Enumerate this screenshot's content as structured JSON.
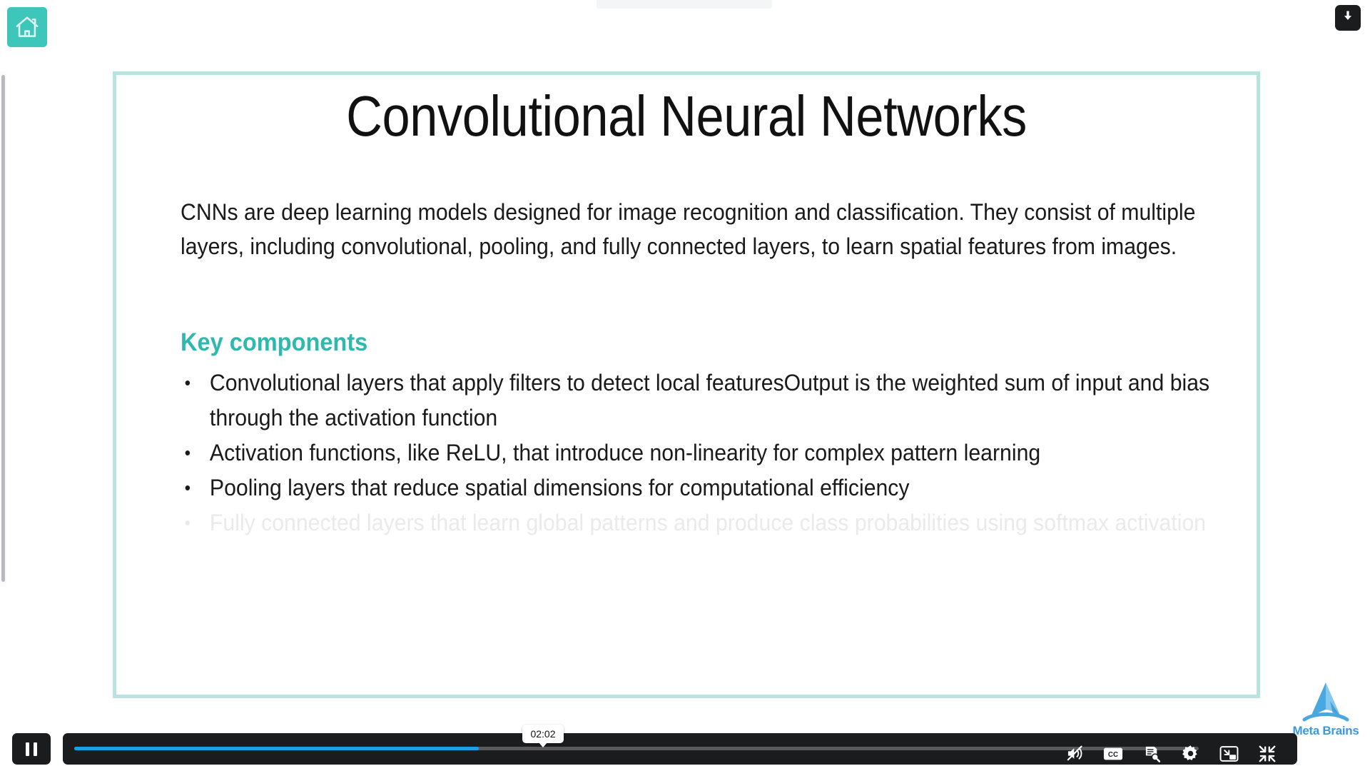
{
  "app": {
    "home_button_icon": "home-icon",
    "download_button_icon": "download-arrow-icon"
  },
  "slide": {
    "title": "Convolutional Neural Networks",
    "intro_paragraph": "CNNs are deep learning models designed for image recognition and classification. They consist of multiple layers, including convolutional, pooling, and fully connected layers, to learn spatial features from images.",
    "section_heading": "Key components",
    "section_heading_color": "#2fb9ae",
    "border_color": "#b9e3e1",
    "bullets": [
      {
        "text": "Convolutional layers that apply filters to detect local featuresOutput is the weighted sum of input and bias through the activation function",
        "faded": false
      },
      {
        "text": "Activation functions, like ReLU, that introduce non-linearity for complex pattern learning",
        "faded": false
      },
      {
        "text": "Pooling layers that reduce spatial dimensions for computational efficiency",
        "faded": false
      },
      {
        "text": "Fully connected layers that learn global patterns and produce class probabilities using softmax activation",
        "faded": true
      }
    ]
  },
  "watermark": {
    "brand": "Meta Brains",
    "logo_color": "#3d9ada"
  },
  "player": {
    "play_state": "playing",
    "play_pause_icon": "pause-icon",
    "current_time": "02:02",
    "progress_percent": 36,
    "progress_fill_color": "#18a0e8",
    "track_color": "#5a5a5c",
    "bar_background": "#1b1c1e",
    "controls": [
      {
        "name": "mute-toggle",
        "icon": "speaker-muted-icon",
        "label": "Mute"
      },
      {
        "name": "captions-toggle",
        "icon": "cc-icon",
        "label": "CC"
      },
      {
        "name": "transcript-button",
        "icon": "transcript-search-icon",
        "label": "Transcript"
      },
      {
        "name": "settings-button",
        "icon": "gear-icon",
        "label": "Settings"
      },
      {
        "name": "picture-in-picture-button",
        "icon": "picture-in-picture-icon",
        "label": "Picture in picture"
      },
      {
        "name": "exit-fullscreen-button",
        "icon": "exit-fullscreen-icon",
        "label": "Exit fullscreen"
      }
    ]
  }
}
